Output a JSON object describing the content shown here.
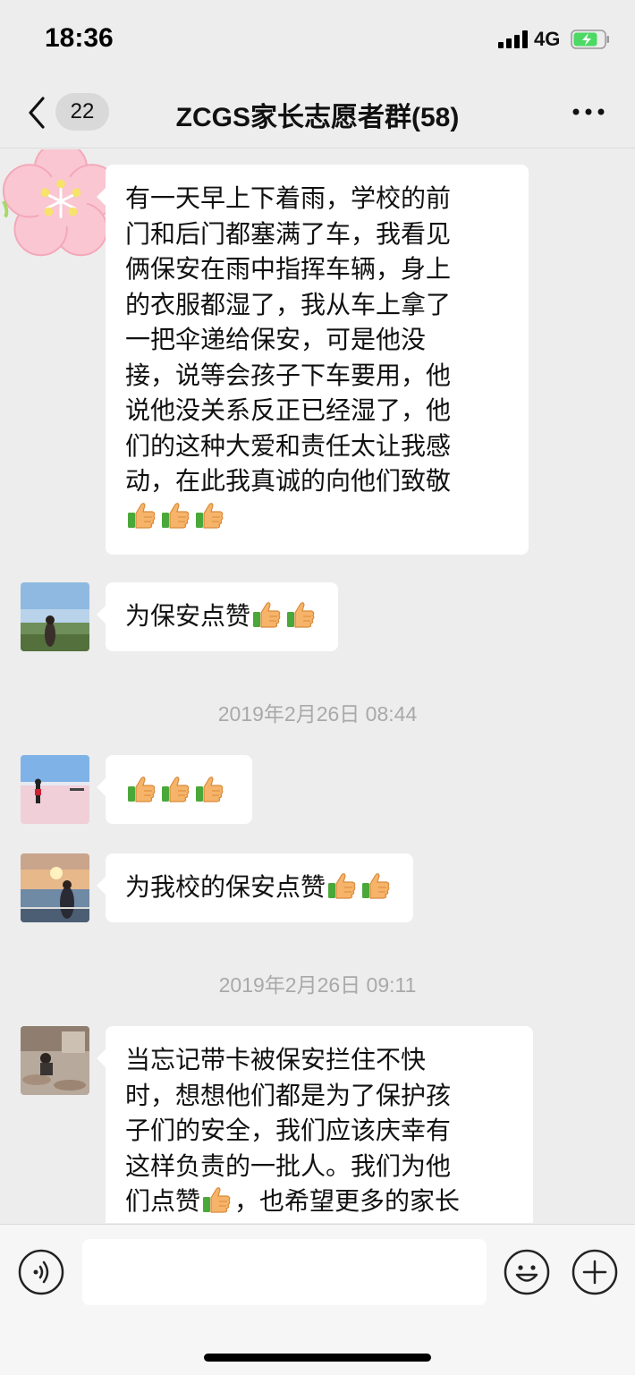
{
  "status_bar": {
    "time": "18:36",
    "network": "4G"
  },
  "nav": {
    "unread_count": "22",
    "title": "ZCGS家长志愿者群(58)"
  },
  "messages": [
    {
      "type": "text",
      "lines": [
        "有一天早上下着雨，学校的前",
        "门和后门都塞满了车，我看见",
        "俩保安在雨中指挥车辆，身上",
        "的衣服都湿了，我从车上拿了",
        "一把伞递给保安，可是他没",
        "接，说等会孩子下车要用，他",
        "说他没关系反正已经湿了，他",
        "们的这种大爱和责任太让我感",
        "动，在此我真诚的向他们致敬"
      ],
      "emoji": [
        "thumbs-up",
        "thumbs-up",
        "thumbs-up"
      ]
    },
    {
      "type": "text",
      "text": "为保安点赞",
      "emoji": [
        "thumbs-up",
        "thumbs-up"
      ]
    },
    {
      "type": "time",
      "text": "2019年2月26日 08:44"
    },
    {
      "type": "emoji-only",
      "emoji": [
        "thumbs-up",
        "thumbs-up",
        "thumbs-up"
      ]
    },
    {
      "type": "text",
      "text": "为我校的保安点赞",
      "emoji": [
        "thumbs-up",
        "thumbs-up"
      ]
    },
    {
      "type": "time",
      "text": "2019年2月26日 09:11"
    },
    {
      "type": "text",
      "lines": [
        "当忘记带卡被保安拦住不快",
        "时，想想他们都是为了保护孩",
        "子们的安全，我们应该庆幸有",
        "这样负责的一批人。我们为他"
      ],
      "line5_before": "们点赞",
      "line5_after": "，也希望更多的家长"
    }
  ],
  "colors": {
    "background": "#ededed",
    "bubble": "#ffffff",
    "timestamp": "#a9a9a9",
    "battery_fill": "#4cd964"
  },
  "icons": [
    "back-chevron-icon",
    "more-icon",
    "voice-icon",
    "emoji-icon",
    "plus-icon",
    "thumbs-up-icon"
  ]
}
